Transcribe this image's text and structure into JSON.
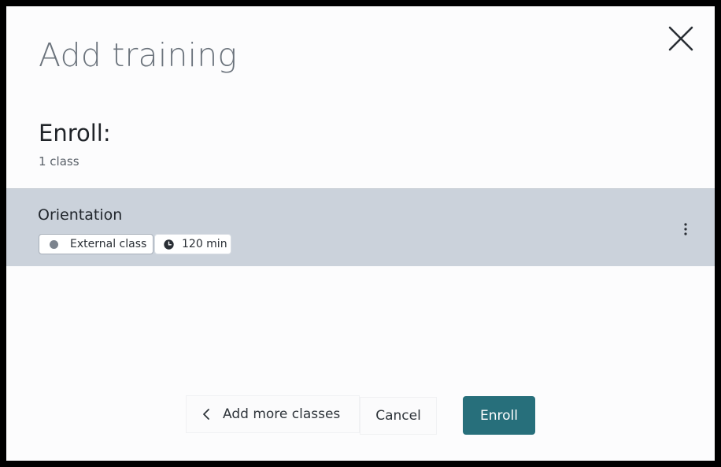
{
  "dialog": {
    "title": "Add training",
    "close_icon": "close-icon"
  },
  "enroll": {
    "heading": "Enroll:",
    "count": "1 class"
  },
  "classes": [
    {
      "name": "Orientation",
      "tags": {
        "type_label": "External class",
        "type_icon": "dot-icon",
        "duration_label": "120 min",
        "duration_icon": "clock-icon"
      },
      "menu_icon": "more-vertical-icon"
    }
  ],
  "footer": {
    "add_more_label": "Add more classes",
    "add_more_icon": "chevron-left-icon",
    "cancel_label": "Cancel",
    "enroll_label": "Enroll"
  },
  "colors": {
    "primary": "#276f7b",
    "selected_row": "#cbd2db",
    "page_background": "#fcfcfd",
    "title_text": "#6b737c"
  }
}
